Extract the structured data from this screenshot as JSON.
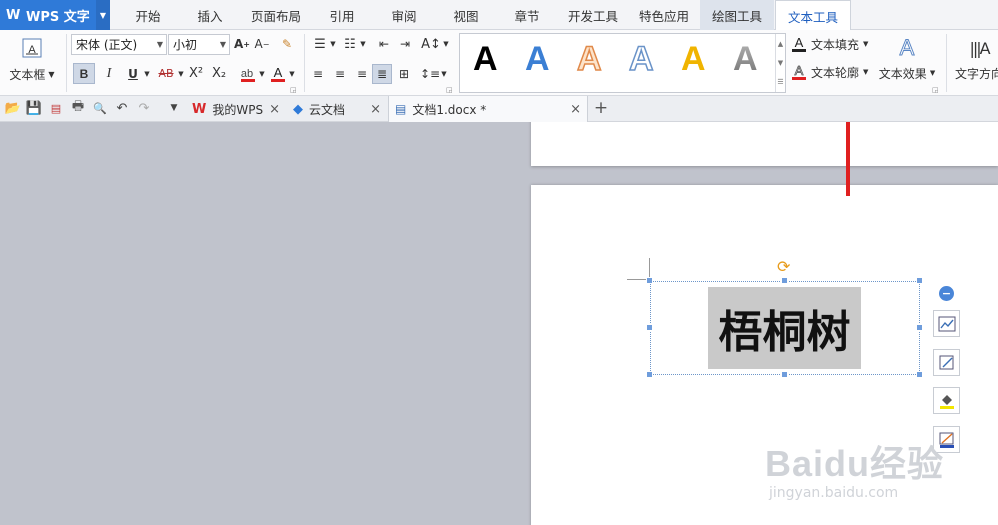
{
  "app": {
    "brand": "WPS 文字",
    "logo": "W"
  },
  "menu_tabs": [
    {
      "label": "开始"
    },
    {
      "label": "插入"
    },
    {
      "label": "页面布局"
    },
    {
      "label": "引用"
    },
    {
      "label": "审阅"
    },
    {
      "label": "视图"
    },
    {
      "label": "章节"
    },
    {
      "label": "开发工具"
    },
    {
      "label": "特色应用"
    },
    {
      "label": "绘图工具"
    },
    {
      "label": "文本工具"
    }
  ],
  "active_tab": "文本工具",
  "ribbon": {
    "textbox_label": "文本框",
    "font_name": "宋体 (正文)",
    "font_size": "小初",
    "bold": "B",
    "italic": "I",
    "underline": "U",
    "strike": "AB",
    "superscript": "X²",
    "subscript": "X₂",
    "styles": [
      {
        "letter": "A",
        "color": "#000000",
        "kind": "solid"
      },
      {
        "letter": "A",
        "color": "#3b7fd4",
        "kind": "solid"
      },
      {
        "letter": "A",
        "color": "#e0894a",
        "kind": "outline"
      },
      {
        "letter": "A",
        "color": "#6a93c8",
        "kind": "outline"
      },
      {
        "letter": "A",
        "color": "#f0b400",
        "kind": "solid"
      },
      {
        "letter": "A",
        "color": "#707070",
        "kind": "gradient"
      }
    ],
    "text_fill": "文本填充",
    "text_outline": "文本轮廓",
    "text_effect": "文本效果",
    "text_direction": "文字方向"
  },
  "doc_tabs": [
    {
      "label": "我的WPS",
      "icon": "wps-icon"
    },
    {
      "label": "云文档",
      "icon": "cloud-cube-icon"
    },
    {
      "label": "文档1.docx *",
      "icon": "document-icon"
    }
  ],
  "textbox_content": "梧桐树",
  "watermark": {
    "main": "Baidu经验",
    "sub": "jingyan.baidu.com"
  },
  "colors": {
    "accent": "#2f7ad8",
    "arrow": "#e02020",
    "selection_fill": "#c9c9c9"
  }
}
